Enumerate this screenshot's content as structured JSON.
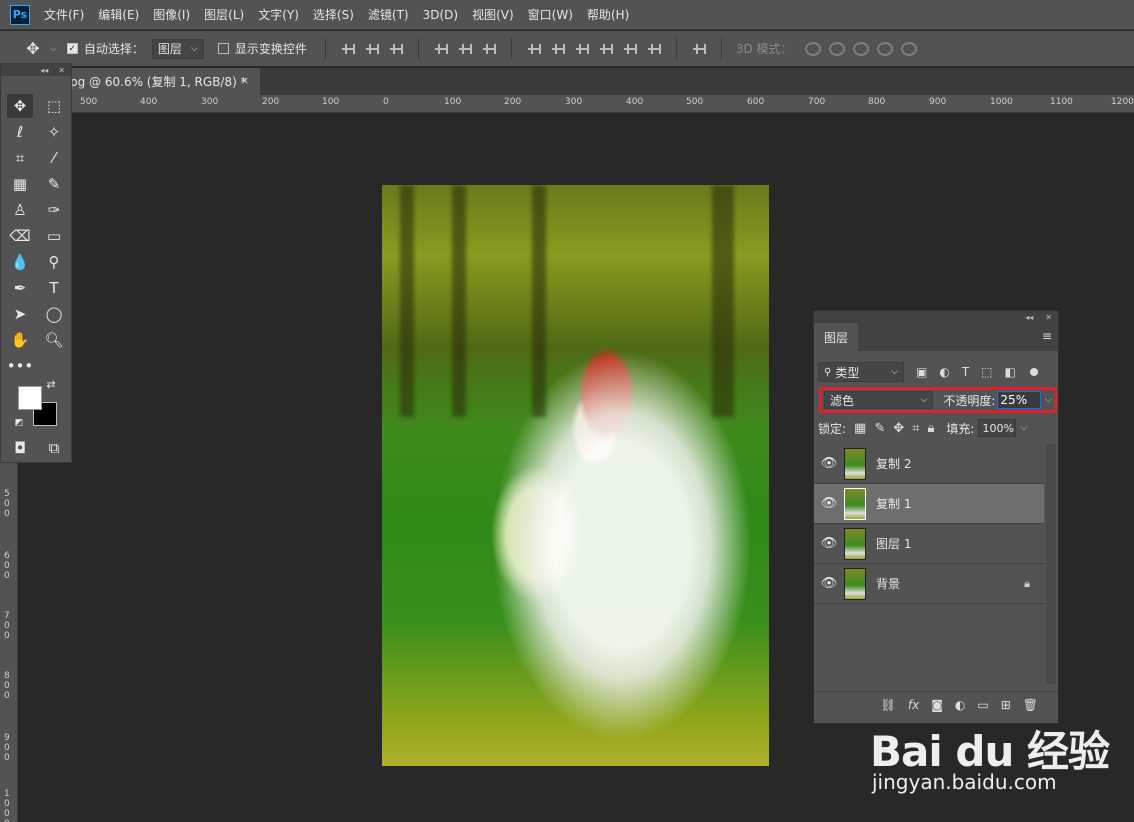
{
  "menubar": {
    "logo": "Ps",
    "items": [
      "文件(F)",
      "编辑(E)",
      "图像(I)",
      "图层(L)",
      "文字(Y)",
      "选择(S)",
      "滤镜(T)",
      "3D(D)",
      "视图(V)",
      "窗口(W)",
      "帮助(H)"
    ]
  },
  "options": {
    "auto_select_label": "自动选择：",
    "auto_select_value": "图层",
    "show_transform_label": "显示变换控件",
    "mode3d_label": "3D 模式："
  },
  "document": {
    "tab_title": "pg @ 60.6% (复制 1, RGB/8) *",
    "close": "×"
  },
  "ruler": {
    "h_labels": [
      "500",
      "400",
      "300",
      "200",
      "100",
      "0",
      "100",
      "200",
      "300",
      "400",
      "500",
      "600",
      "700",
      "800",
      "900",
      "1000",
      "1100",
      "1200"
    ],
    "v_labels": [
      "500",
      "600",
      "700",
      "800",
      "900",
      "1000"
    ]
  },
  "layers_panel": {
    "tab": "图层",
    "filter_value": "类型",
    "blend_mode": "滤色",
    "opacity_label": "不透明度:",
    "opacity_value": "25%",
    "lock_label": "锁定:",
    "fill_label": "填充:",
    "fill_value": "100%",
    "layers": [
      {
        "name": "复制 2",
        "selected": false,
        "locked": false
      },
      {
        "name": "复制 1",
        "selected": true,
        "locked": false
      },
      {
        "name": "图层 1",
        "selected": false,
        "locked": false
      },
      {
        "name": "背景",
        "selected": false,
        "locked": true
      }
    ]
  },
  "colors": {
    "foreground": "#ffffff",
    "background": "#000000",
    "highlight": "#e0202a"
  },
  "watermark": {
    "logo": "Bai du 经验",
    "url": "jingyan.baidu.com"
  }
}
